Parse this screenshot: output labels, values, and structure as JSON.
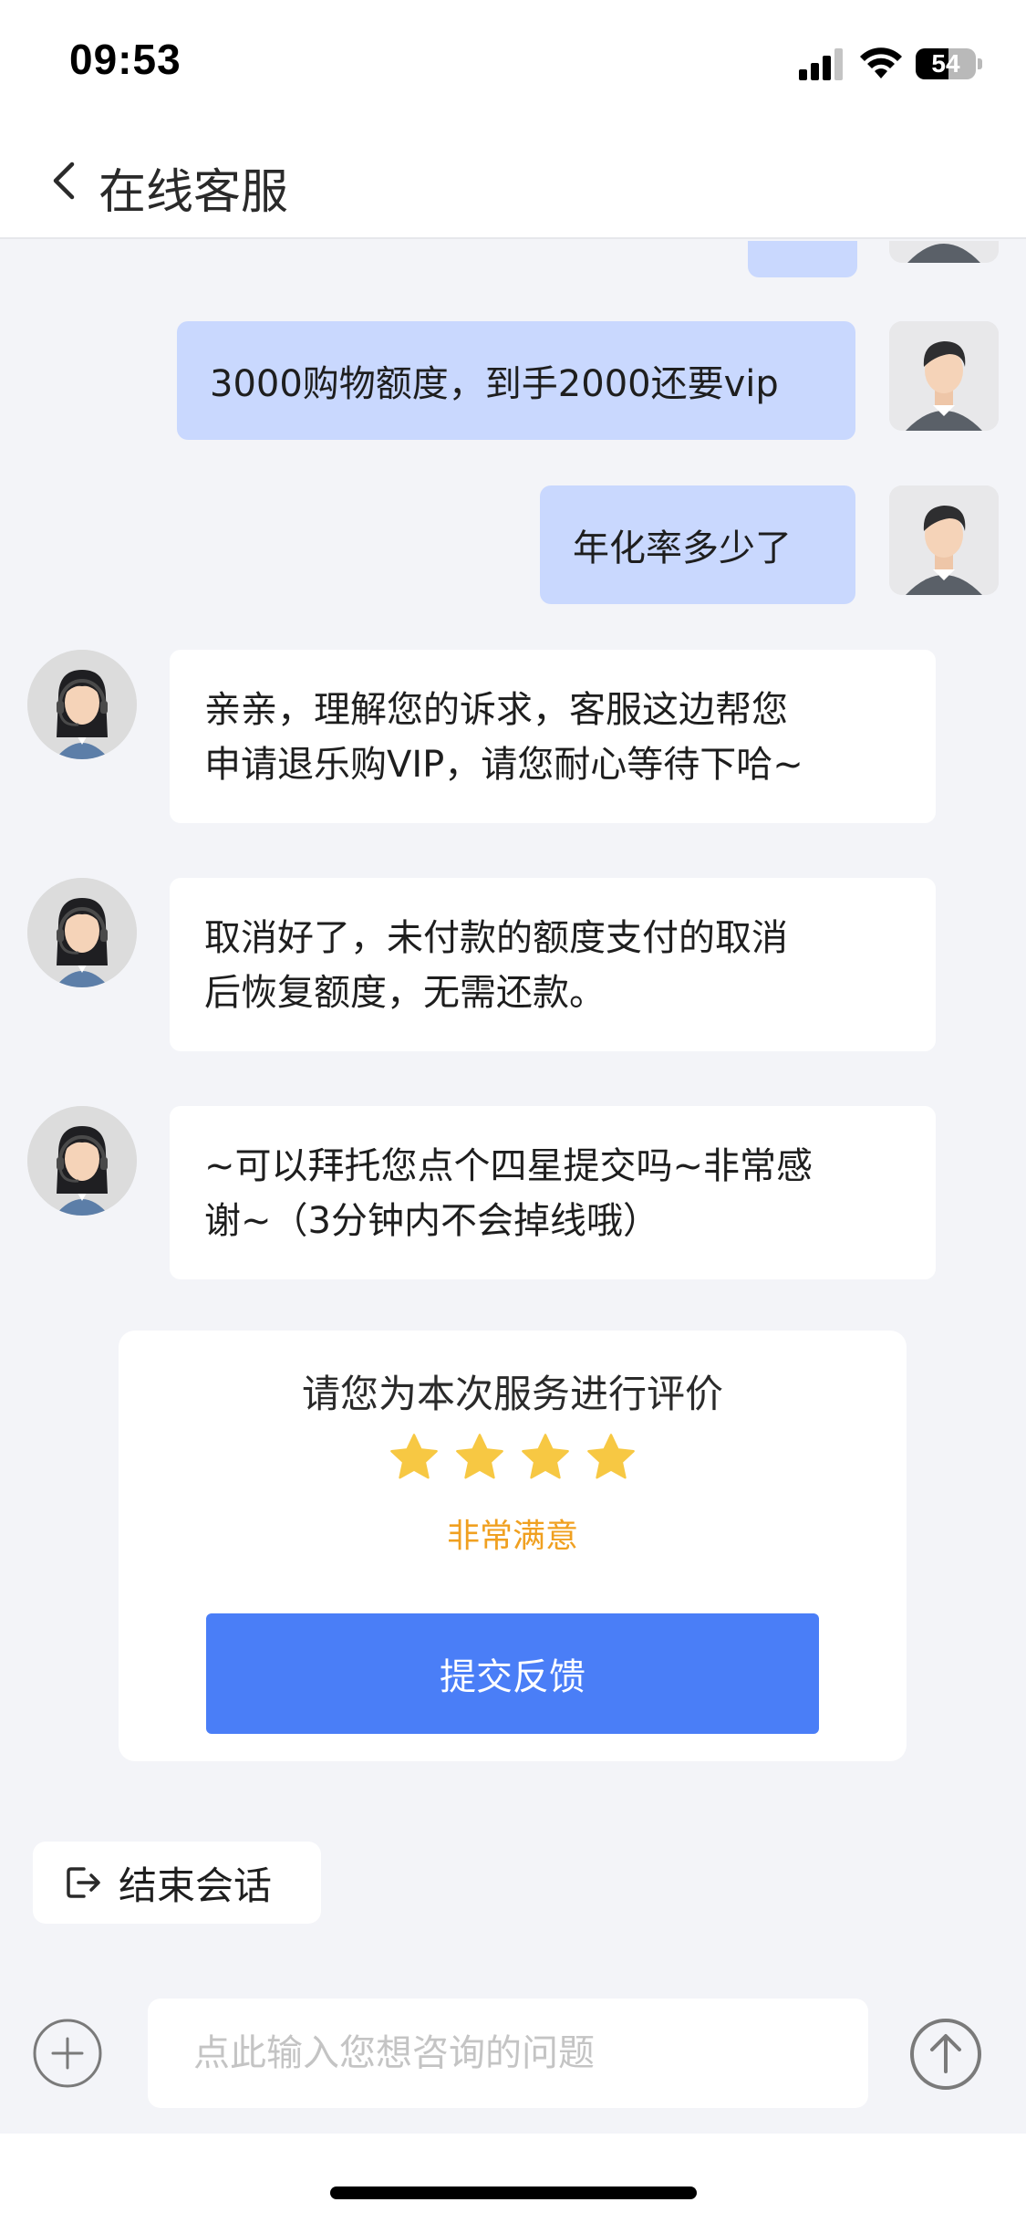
{
  "status_bar": {
    "time": "09:53",
    "battery": "54",
    "icons": [
      "signal-icon",
      "wifi-icon",
      "battery-icon"
    ]
  },
  "header": {
    "title": "在线客服",
    "back_icon": "chevron-left-icon"
  },
  "messages": [
    {
      "from": "user",
      "text": "3000购物额度，到手2000还要vip"
    },
    {
      "from": "user",
      "text": "年化率多少了"
    },
    {
      "from": "agent",
      "lines": [
        "亲亲，理解您的诉求，客服这边帮您",
        "申请退乐购VIP，请您耐心等待下哈~"
      ]
    },
    {
      "from": "agent",
      "lines": [
        "取消好了，未付款的额度支付的取消",
        "后恢复额度，无需还款。"
      ]
    },
    {
      "from": "agent",
      "lines": [
        "~可以拜托您点个四星提交吗~非常感",
        "谢~（3分钟内不会掉线哦）"
      ]
    }
  ],
  "rating": {
    "prompt": "请您为本次服务进行评价",
    "stars_filled": 4,
    "label": "非常满意",
    "submit_label": "提交反馈",
    "star_color": "#f7c843"
  },
  "end_session": {
    "label": "结束会话",
    "icon": "exit-icon"
  },
  "input": {
    "placeholder": "点此输入您想咨询的问题",
    "value": ""
  },
  "colors": {
    "user_bubble": "#c9d8fe",
    "primary": "#4a7ef7",
    "rating_label": "#f0a020",
    "background": "#f3f4f8"
  }
}
